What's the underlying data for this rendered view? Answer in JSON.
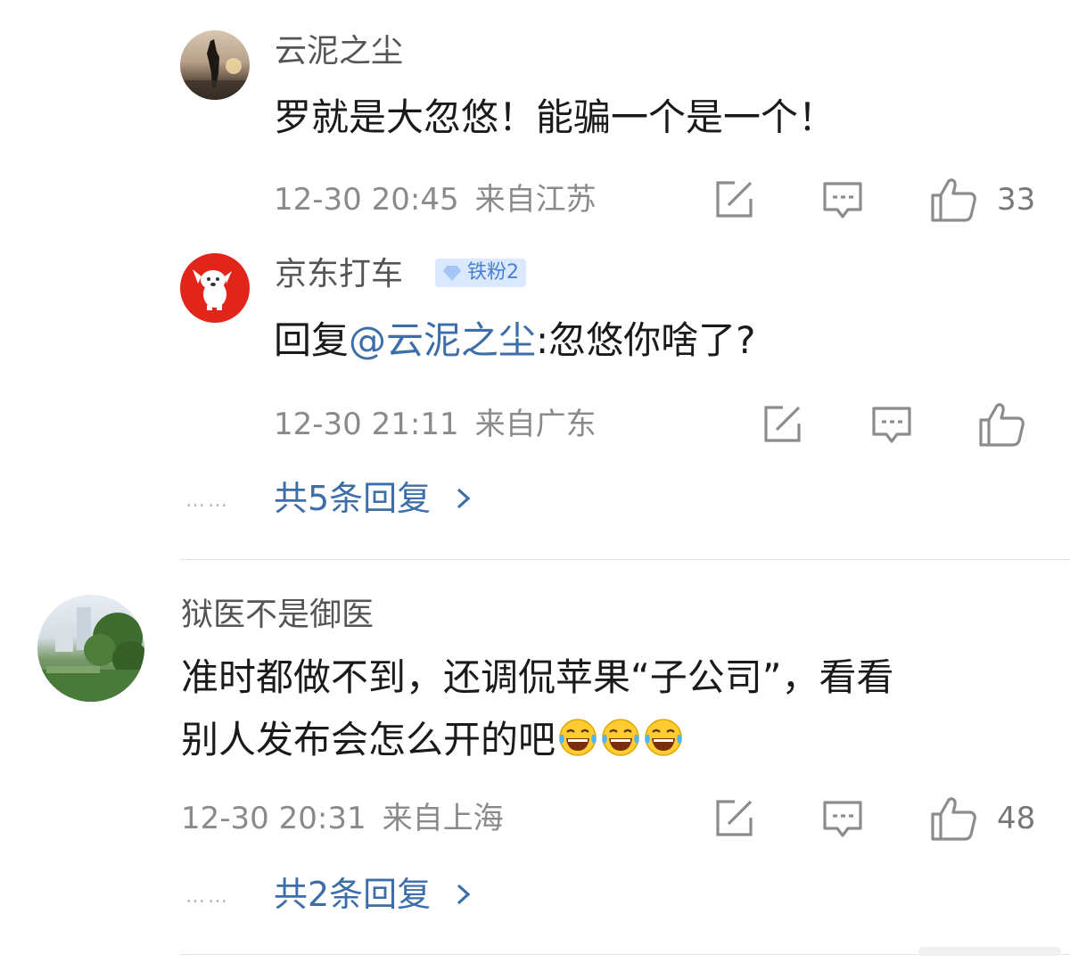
{
  "comments": [
    {
      "username": "云泥之尘",
      "text": "罗就是大忽悠！能骗一个是一个！",
      "time": "12-30 20:45",
      "location": "来自江苏",
      "likes": "33",
      "replies": [
        {
          "username": "京东打车",
          "badge": "铁粉2",
          "reply_prefix": "回复",
          "mention": "@云泥之尘",
          "text": ":忽悠你啥了?",
          "time": "12-30 21:11",
          "location": "来自广东"
        }
      ],
      "more_dots": "……",
      "more_replies": "共5条回复"
    },
    {
      "username": "狱医不是御医",
      "text_line1": "准时都做不到，还调侃苹果“子公司”，看看",
      "text_line2": "别人发布会怎么开的吧",
      "emojis": [
        "laughing-tears-emoji",
        "laughing-tears-emoji",
        "laughing-tears-emoji"
      ],
      "time": "12-30 20:31",
      "location": "来自上海",
      "likes": "48",
      "more_dots": "……",
      "more_replies": "共2条回复"
    }
  ],
  "icons": {
    "share": "share-icon",
    "comment": "comment-icon",
    "like": "thumbs-up-icon",
    "more": "chevron-right-icon"
  },
  "colors": {
    "link": "#3d6ea8",
    "meta": "#8a8a8a",
    "badge_bg": "#dbe9ff"
  }
}
